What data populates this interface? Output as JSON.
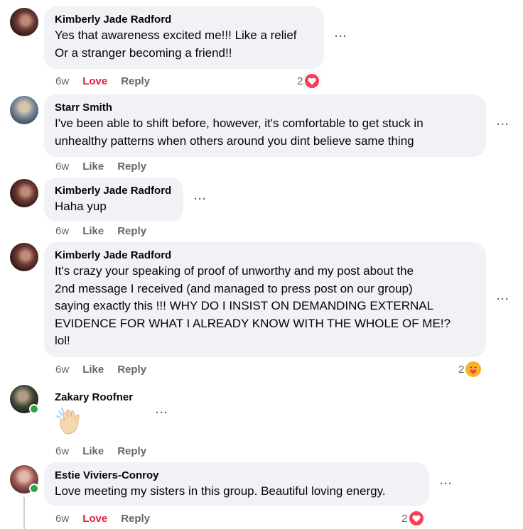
{
  "comments": [
    {
      "author": "Kimberly Jade Radford",
      "text": "Yes that awareness excited me!!! Like a relief\nOr a stranger becoming a friend!!",
      "time": "6w",
      "reaction_action": "Love",
      "reply": "Reply",
      "reaction_count": "2",
      "reaction_type": "heart-icon"
    },
    {
      "author": "Starr Smith",
      "text": "I've been able to shift before, however, it's comfortable to get stuck in\nunhealthy patterns when others around you dint believe same thing",
      "time": "6w",
      "reaction_action": "Like",
      "reply": "Reply"
    },
    {
      "author": "Kimberly Jade Radford",
      "text": "Haha yup",
      "time": "6w",
      "reaction_action": "Like",
      "reply": "Reply"
    },
    {
      "author": "Kimberly Jade Radford",
      "text": "It's crazy your speaking of proof of unworthy and my post about the\n2nd message I received (and managed to press post on our group)\nsaying exactly this !!! WHY DO I INSIST ON DEMANDING EXTERNAL\nEVIDENCE FOR WHAT I ALREADY KNOW WITH THE WHOLE OF ME!?\nlol!",
      "time": "6w",
      "reaction_action": "Like",
      "reply": "Reply",
      "reaction_count": "2",
      "reaction_type": "care-icon"
    },
    {
      "author": "Zakary Roofner",
      "sticker": "waving-hand-icon",
      "time": "6w",
      "reaction_action": "Like",
      "reply": "Reply"
    },
    {
      "author": "Estie Viviers-Conroy",
      "text": "Love meeting my sisters in this group. Beautiful loving energy.",
      "time": "6w",
      "reaction_action": "Love",
      "reply": "Reply",
      "reaction_count": "2",
      "reaction_type": "heart-icon"
    }
  ],
  "more_label": "···",
  "colors": {
    "bubble": "#f0f2f5",
    "meta": "#65676b",
    "love": "#e41e3f",
    "heart": "#f33e58",
    "online": "#31a24c"
  }
}
